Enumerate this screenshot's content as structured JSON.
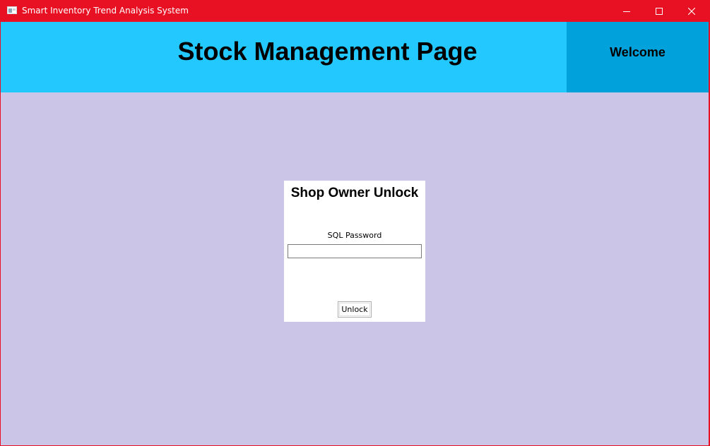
{
  "window": {
    "title": "Smart Inventory Trend Analysis System",
    "titlebar_color": "#e81123",
    "controls": [
      "minimize-icon",
      "maximize-icon",
      "close-icon"
    ]
  },
  "header": {
    "title": "Stock Management Page",
    "background": "#22c8fe",
    "welcome_label": "Welcome",
    "welcome_background": "#01a2db"
  },
  "main": {
    "background": "#cbc5e8"
  },
  "unlock_panel": {
    "title": "Shop Owner Unlock",
    "password_label": "SQL Password",
    "password_value": "",
    "button_label": "Unlock"
  }
}
